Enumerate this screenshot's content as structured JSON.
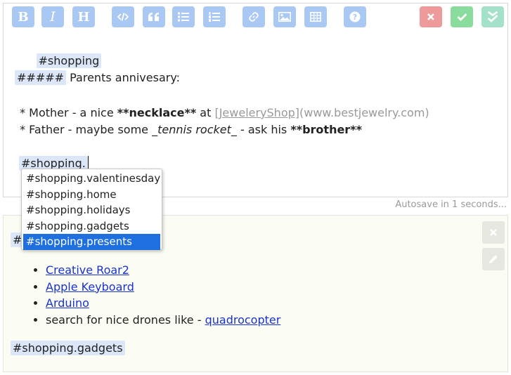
{
  "toolbar": {
    "bold": "B",
    "italic": "I",
    "heading": "H",
    "buttons": [
      {
        "name": "code-icon"
      },
      {
        "name": "quote-icon"
      },
      {
        "name": "bullet-list-icon"
      },
      {
        "name": "numbered-list-icon"
      },
      {
        "name": "link-icon"
      },
      {
        "name": "image-icon"
      },
      {
        "name": "table-icon"
      },
      {
        "name": "help-icon"
      },
      {
        "name": "cancel-icon"
      },
      {
        "name": "save-icon"
      },
      {
        "name": "save-close-icon"
      }
    ],
    "colors": {
      "blue": "#a9c8f3",
      "red": "#ee9a9a",
      "green": "#89dc9c",
      "teal": "#a3e2c8"
    }
  },
  "editor": {
    "line1_tag": "#shopping",
    "line2_hashes": "#####",
    "line2_text": " Parents annivesary:",
    "line3_prefix": " * Mother - a nice ",
    "line3_bold": "**necklace**",
    "line3_mid": " at ",
    "line3_link": "[JeweleryShop]",
    "line3_url": "(www.bestjewelry.com)",
    "line4_prefix": " * Father - maybe some ",
    "line4_italic_open": "_",
    "line4_italic": "tennis rocket",
    "line4_italic_close": "_",
    "line4_mid": " - ask his ",
    "line4_bold": "**brother**",
    "line5_typed": "#shopping."
  },
  "autocomplete": {
    "items": [
      "#shopping.valentinesday",
      "#shopping.home",
      "#shopping.holidays",
      "#shopping.gadgets",
      "#shopping.presents"
    ],
    "selected_index": 4,
    "selected_color": "#1e6fe0"
  },
  "status": {
    "autosave": "Autosave in 1 seconds..."
  },
  "preview": {
    "top_tag_partial": "#",
    "items": [
      {
        "type": "link",
        "text": "Creative Roar2"
      },
      {
        "type": "link",
        "text": "Apple Keyboard"
      },
      {
        "type": "link",
        "text": "Arduino"
      },
      {
        "type": "mixed",
        "text": "search for nice drones like - ",
        "link": "quadrocopter"
      }
    ],
    "bottom_tag": "#shopping.gadgets",
    "side_buttons": [
      {
        "name": "close-icon"
      },
      {
        "name": "edit-icon"
      }
    ]
  }
}
